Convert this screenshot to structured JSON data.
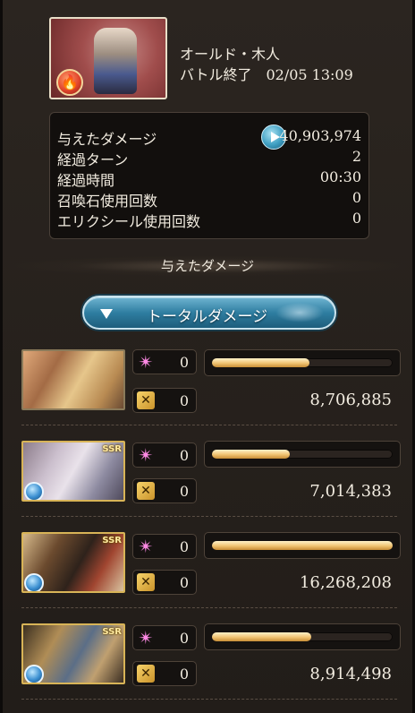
{
  "header": {
    "enemy_name": "オールド・木人",
    "battle_status": "バトル終了　02/05 13:09",
    "enemy_element_icon": "fire-element-icon"
  },
  "stats": [
    {
      "label": "与えたダメージ",
      "value": "40,903,974"
    },
    {
      "label": "経過ターン",
      "value": "2"
    },
    {
      "label": "経過時間",
      "value": "00:30"
    },
    {
      "label": "召喚石使用回数",
      "value": "0"
    },
    {
      "label": "エリクシール使用回数",
      "value": "0"
    }
  ],
  "section_title": "与えたダメージ",
  "dropdown": {
    "label": "トータルダメージ"
  },
  "party": [
    {
      "skill_count": "0",
      "ca_count": "0",
      "damage": "8,706,885",
      "bar_fraction": 0.54,
      "ssr": "",
      "element": ""
    },
    {
      "skill_count": "0",
      "ca_count": "0",
      "damage": "7,014,383",
      "bar_fraction": 0.43,
      "ssr": "SSR",
      "element": "water"
    },
    {
      "skill_count": "0",
      "ca_count": "0",
      "damage": "16,268,208",
      "bar_fraction": 1.0,
      "ssr": "SSR",
      "element": "water"
    },
    {
      "skill_count": "0",
      "ca_count": "0",
      "damage": "8,914,498",
      "bar_fraction": 0.55,
      "ssr": "SSR",
      "element": "water"
    }
  ],
  "icons": {
    "skill": "pink-star-icon",
    "charge_attack": "charge-attack-icon",
    "play": "play-icon",
    "dropdown": "triangle-down-icon"
  },
  "colors": {
    "bar_fill": "#f0c372",
    "dropdown": "#2f7ea1",
    "skill_icon": "#ff8ae6"
  }
}
